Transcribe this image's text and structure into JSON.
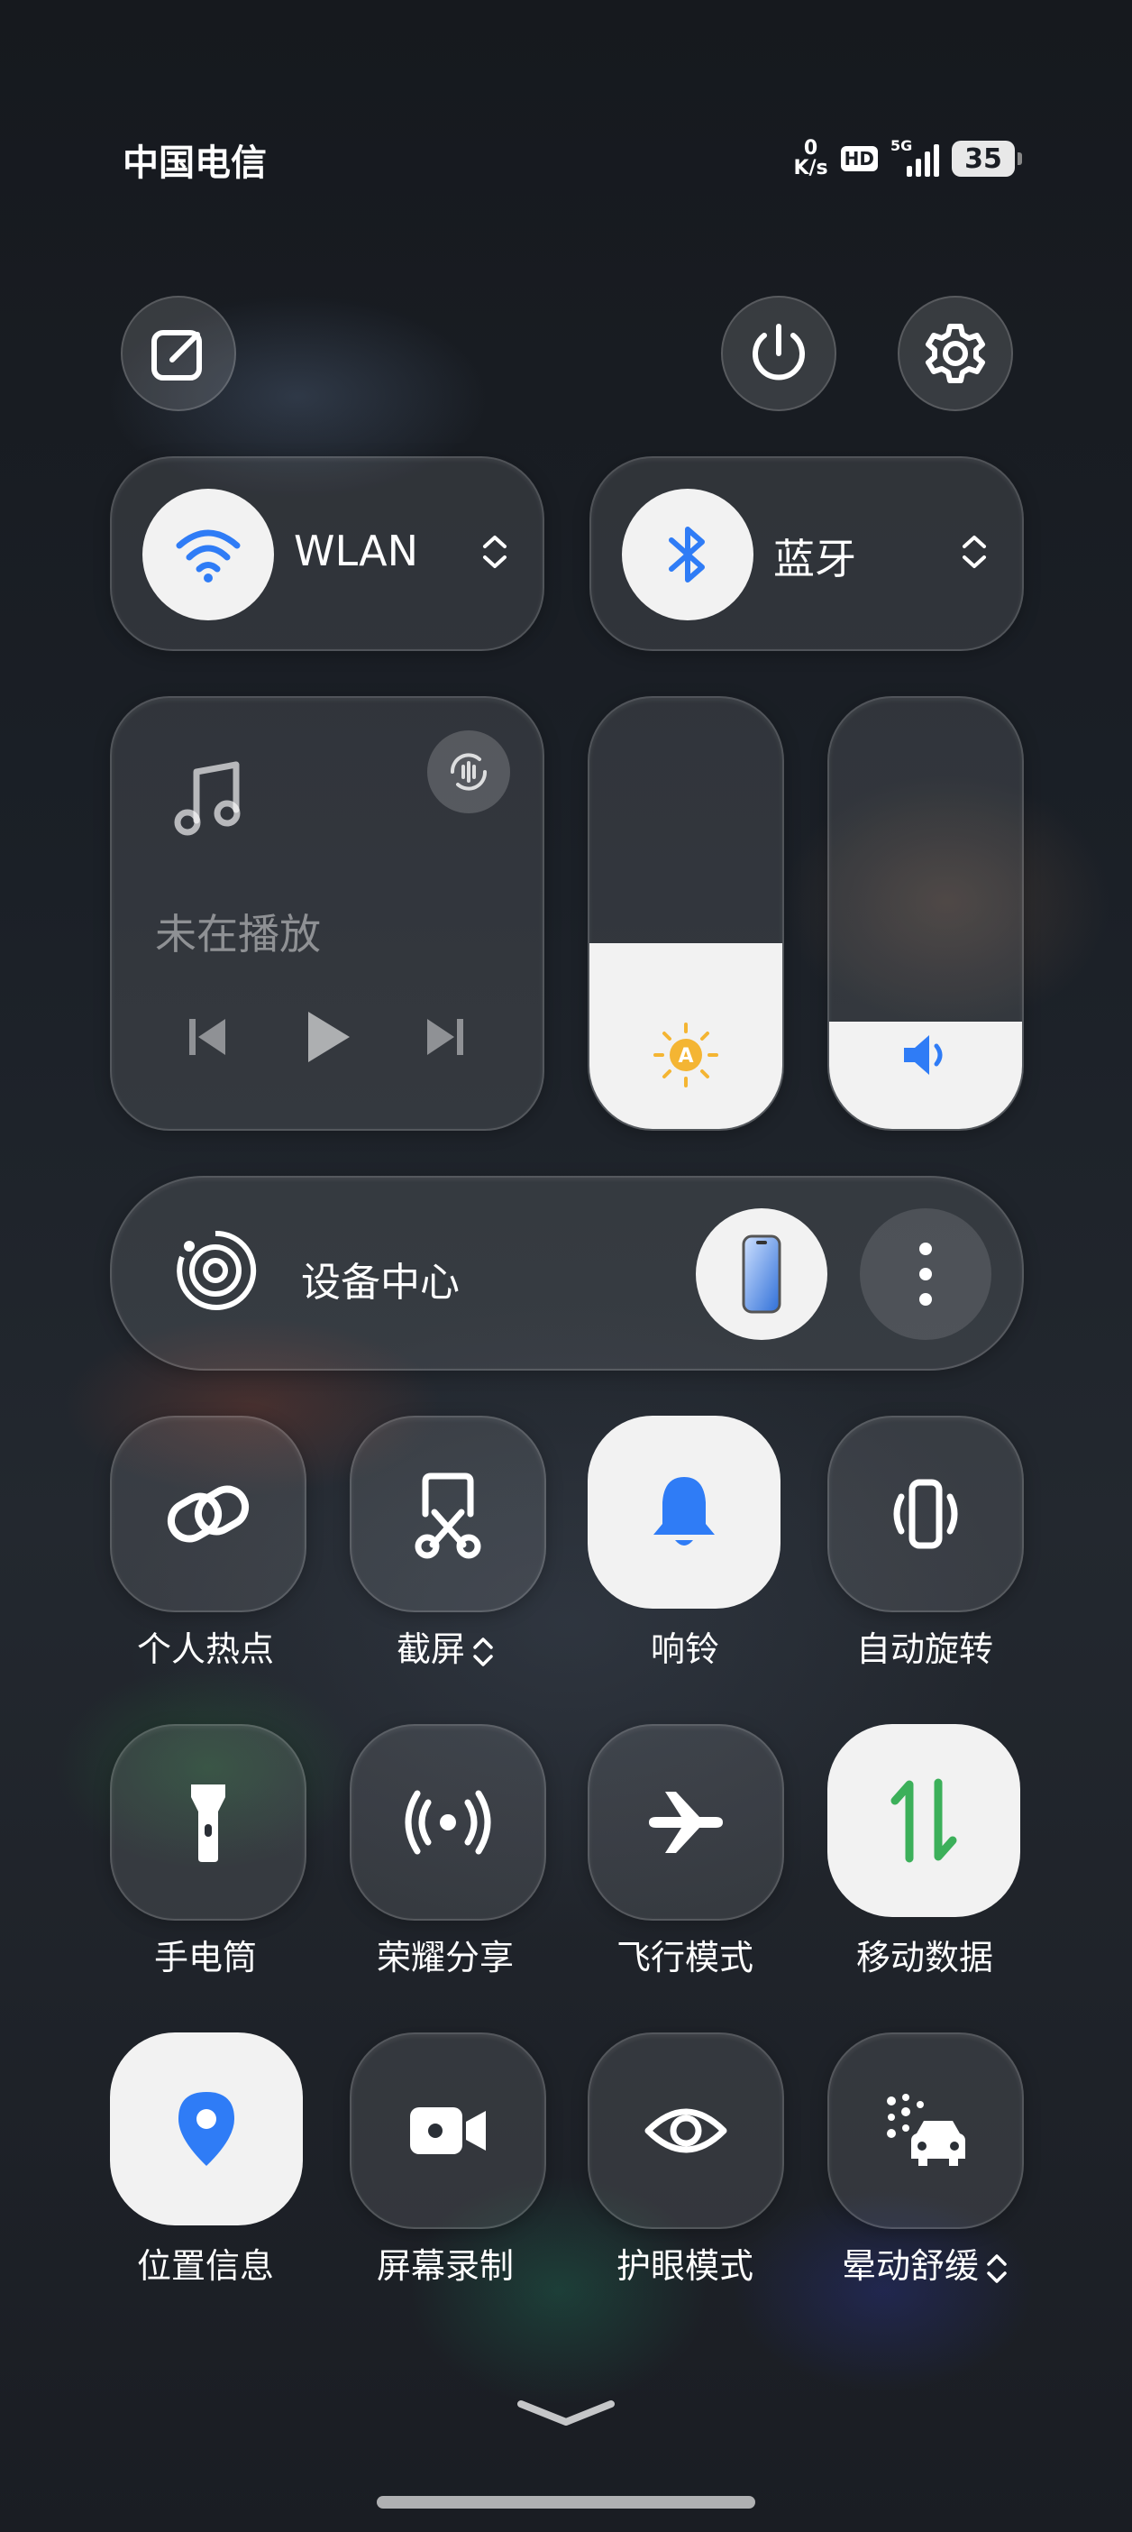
{
  "status_bar": {
    "carrier": "中国电信",
    "net_speed_value": "0",
    "net_speed_unit": "K/s",
    "hd": "HD",
    "network_type": "5G",
    "battery": "35"
  },
  "top_actions": [
    "edit-icon",
    "power-icon",
    "settings-icon"
  ],
  "wlan": {
    "label": "WLAN",
    "icon": "wifi-icon",
    "active": true
  },
  "bluetooth": {
    "label": "蓝牙",
    "icon": "bluetooth-icon",
    "active": true
  },
  "media": {
    "status": "未在播放"
  },
  "brightness": {
    "level": 0.43
  },
  "volume": {
    "level": 0.25
  },
  "device_center": {
    "label": "设备中心"
  },
  "tiles": [
    {
      "label": "个人热点",
      "icon": "hotspot-icon",
      "active": false
    },
    {
      "label": "截屏",
      "icon": "screenshot-icon",
      "active": false,
      "has_menu": true
    },
    {
      "label": "响铃",
      "icon": "bell-icon",
      "active": true
    },
    {
      "label": "自动旋转",
      "icon": "auto-rotate-icon",
      "active": false
    },
    {
      "label": "手电筒",
      "icon": "flashlight-icon",
      "active": false
    },
    {
      "label": "荣耀分享",
      "icon": "share-icon",
      "active": false
    },
    {
      "label": "飞行模式",
      "icon": "airplane-icon",
      "active": false
    },
    {
      "label": "移动数据",
      "icon": "mobile-data-icon",
      "active": true
    },
    {
      "label": "位置信息",
      "icon": "location-icon",
      "active": true
    },
    {
      "label": "屏幕录制",
      "icon": "screen-record-icon",
      "active": false
    },
    {
      "label": "护眼模式",
      "icon": "eye-icon",
      "active": false
    },
    {
      "label": "晕动舒缓",
      "icon": "motion-sickness-icon",
      "active": false,
      "has_menu": true
    }
  ],
  "colors": {
    "accent_blue": "#2f7cf6",
    "brightness_yellow": "#f4b533",
    "data_green": "#3cb05a"
  }
}
